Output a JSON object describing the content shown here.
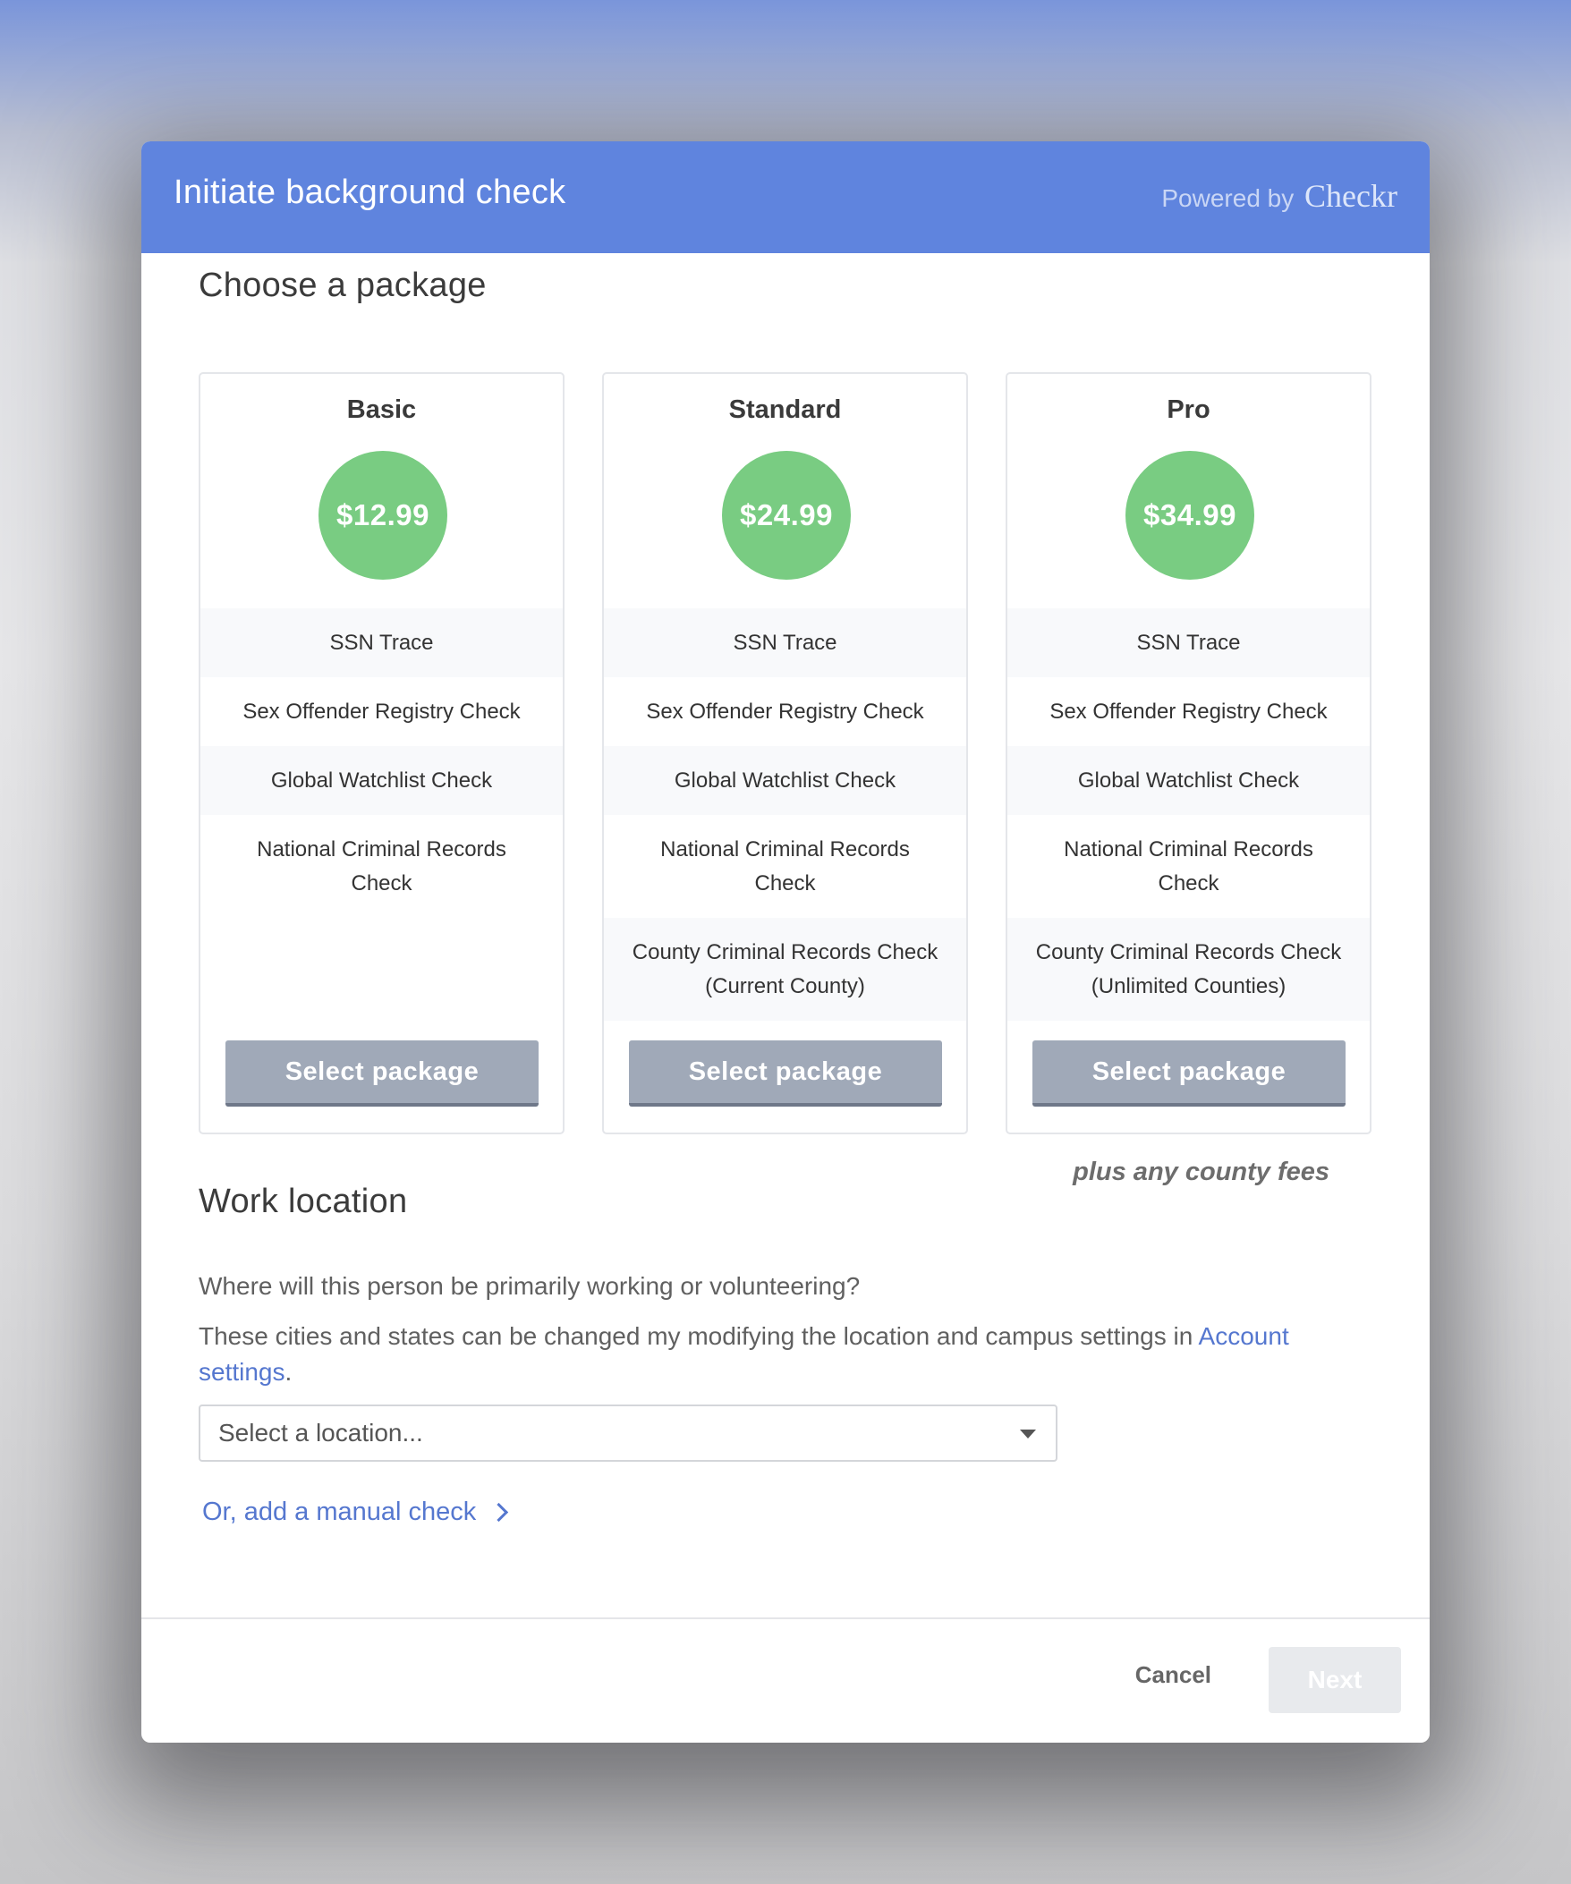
{
  "modal": {
    "title": "Initiate background check",
    "powered_by": "Powered by",
    "brand": "Checkr"
  },
  "packages_section": {
    "title": "Choose a package",
    "fee_note": "plus any county fees",
    "packages": [
      {
        "name": "Basic",
        "price": "$12.99",
        "features": [
          "SSN Trace",
          "Sex Offender Registry Check",
          "Global Watchlist Check",
          "National Criminal Records Check"
        ],
        "button_label": "Select package"
      },
      {
        "name": "Standard",
        "price": "$24.99",
        "features": [
          "SSN Trace",
          "Sex Offender Registry Check",
          "Global Watchlist Check",
          "National Criminal Records Check",
          "County Criminal Records Check (Current County)"
        ],
        "button_label": "Select package"
      },
      {
        "name": "Pro",
        "price": "$34.99",
        "features": [
          "SSN Trace",
          "Sex Offender Registry Check",
          "Global Watchlist Check",
          "National Criminal Records Check",
          "County Criminal Records Check (Unlimited Counties)"
        ],
        "button_label": "Select package"
      }
    ]
  },
  "work_location": {
    "title": "Work location",
    "question": "Where will this person be primarily working or volunteering?",
    "info_text": "These cities and states can be changed my modifying the location and campus settings in",
    "info_link": "Account settings",
    "info_end": ".",
    "select_placeholder": "Select a location...",
    "manual_check_link": "Or, add a manual check"
  },
  "footer": {
    "cancel_label": "Cancel",
    "next_label": "Next"
  },
  "colors": {
    "header": "#5f84de",
    "price_badge": "#79cc82",
    "select_button": "#a0a9b8",
    "link": "#5577cf"
  }
}
